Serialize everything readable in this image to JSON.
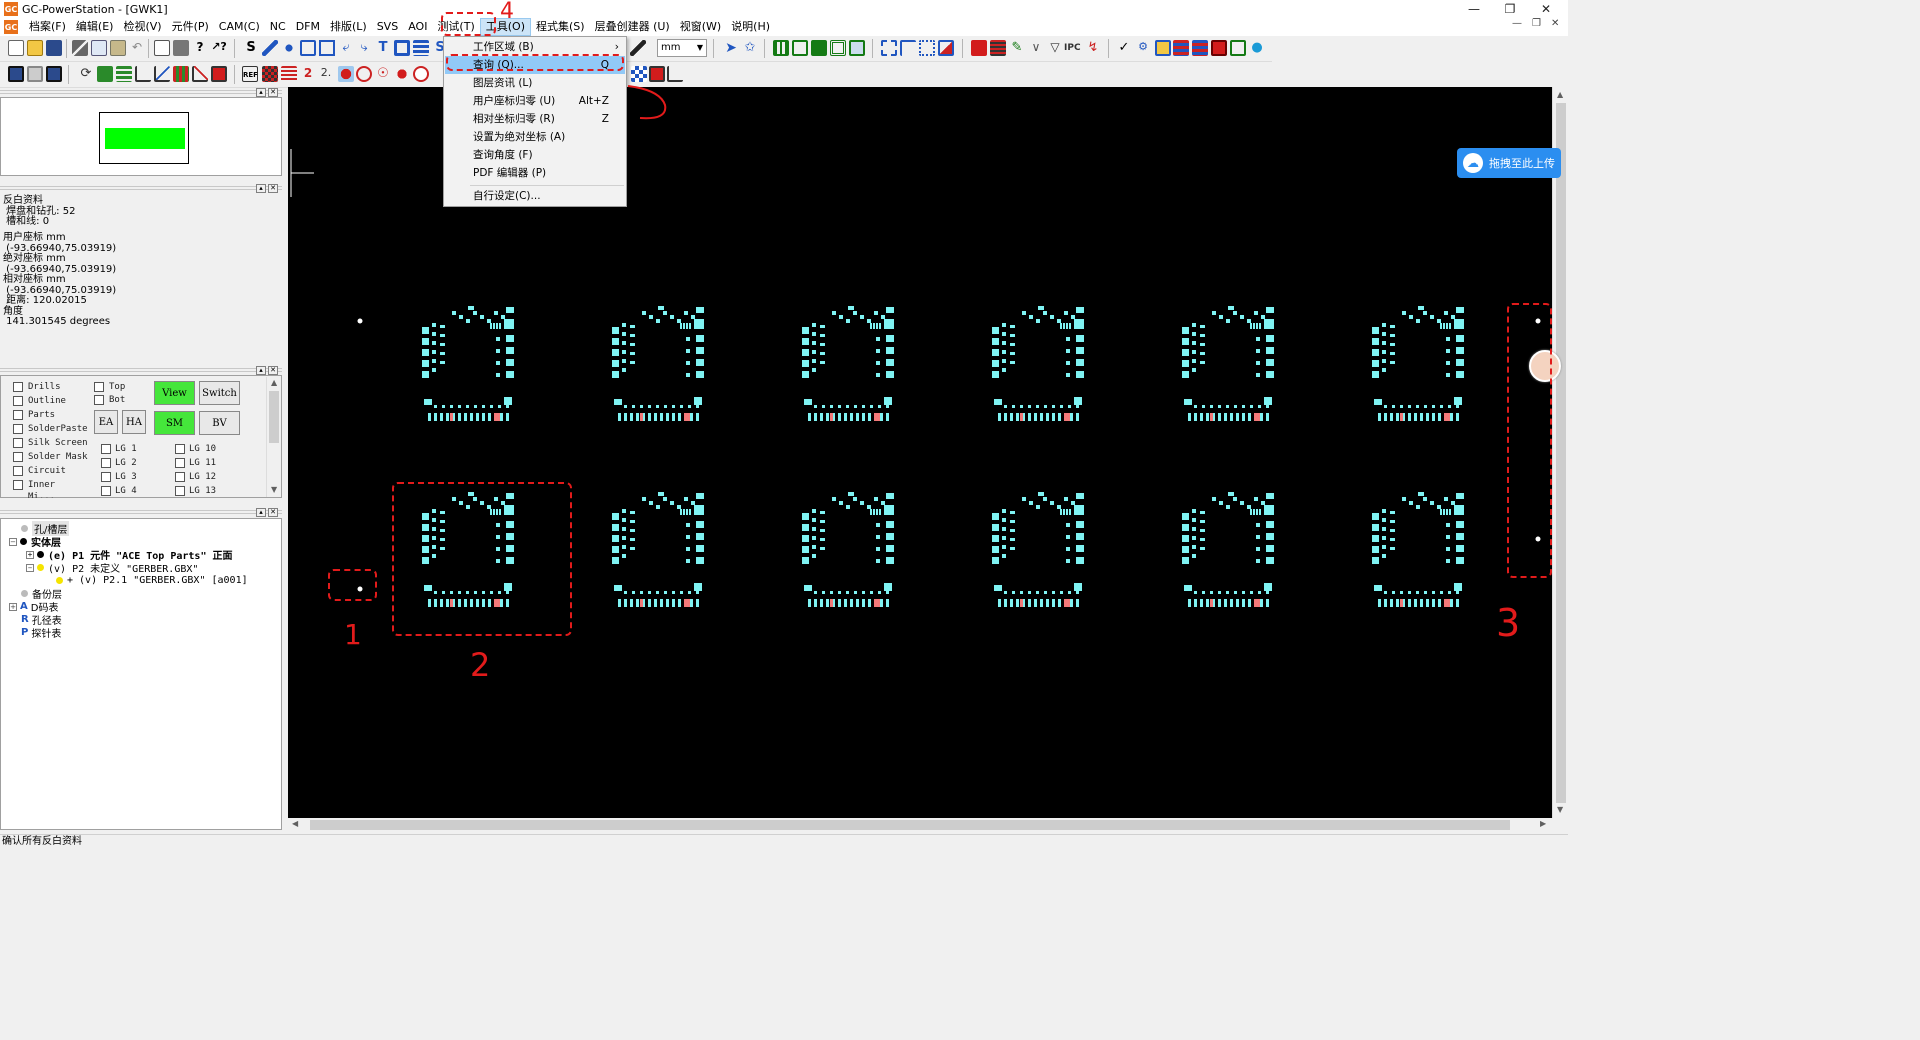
{
  "window": {
    "title": "GC-PowerStation - [GWK1]",
    "logo_text": "GC"
  },
  "menubar": {
    "items": [
      {
        "label": "档案(F)"
      },
      {
        "label": "编辑(E)"
      },
      {
        "label": "检视(V)"
      },
      {
        "label": "元件(P)"
      },
      {
        "label": "CAM(C)"
      },
      {
        "label": "NC"
      },
      {
        "label": "DFM"
      },
      {
        "label": "排版(L)"
      },
      {
        "label": "SVS"
      },
      {
        "label": "AOI"
      },
      {
        "label": "测试(T)"
      },
      {
        "label": "工具(O)"
      },
      {
        "label": "程式集(S)"
      },
      {
        "label": "层叠创建器 (U)"
      },
      {
        "label": "视窗(W)"
      },
      {
        "label": "说明(H)"
      }
    ]
  },
  "toolbar": {
    "unit_select": "mm"
  },
  "tools_menu": {
    "items": [
      {
        "label": "工作区域 (B)",
        "shortcut": "",
        "submenu": true
      },
      {
        "label": "查询 (Q)...",
        "shortcut": "Q",
        "highlighted": true
      },
      {
        "label": "图层资讯 (L)",
        "shortcut": ""
      },
      {
        "label": "用户座标归零 (U)",
        "shortcut": "Alt+Z"
      },
      {
        "label": "相对坐标归零 (R)",
        "shortcut": "Z"
      },
      {
        "label": "设置为绝对坐标 (A)",
        "shortcut": ""
      },
      {
        "label": "查询角度 (F)",
        "shortcut": ""
      },
      {
        "label": "PDF 编辑器 (P)",
        "shortcut": ""
      },
      {
        "label": "自行设定(C)...",
        "shortcut": ""
      }
    ]
  },
  "info_panel": {
    "lines": [
      "反白资料",
      " 焊盘和钻孔: 52",
      " 槽和线: 0",
      "用户座标 mm",
      " (-93.66940,75.03919)",
      "绝对座标 mm",
      " (-93.66940,75.03919)",
      "相对座标 mm",
      " (-93.66940,75.03919)",
      " 距离: 120.02015",
      "角度",
      " 141.301545 degrees"
    ]
  },
  "layer_panel": {
    "layers": [
      {
        "label": "Drills"
      },
      {
        "label": "Outline"
      },
      {
        "label": "Parts"
      },
      {
        "label": "SolderPaste"
      },
      {
        "label": "Silk Screen"
      },
      {
        "label": "Solder Mask"
      },
      {
        "label": "Circuit"
      },
      {
        "label": "Inner"
      },
      {
        "label": "Mi..."
      }
    ],
    "sides": [
      {
        "label": "Top"
      },
      {
        "label": "Bot"
      }
    ],
    "buttons": {
      "view": "View",
      "switch": "Switch",
      "ea": "EA",
      "ha": "HA",
      "sm": "SM",
      "bv": "BV"
    },
    "lg_left": [
      {
        "label": "LG 1"
      },
      {
        "label": "LG 2"
      },
      {
        "label": "LG 3"
      },
      {
        "label": "LG 4"
      }
    ],
    "lg_right": [
      {
        "label": "LG 10"
      },
      {
        "label": "LG 11"
      },
      {
        "label": "LG 12"
      },
      {
        "label": "LG 13"
      }
    ],
    "accent_color": "#45e63b"
  },
  "tree_panel": {
    "rows": [
      {
        "label": "孔/槽层"
      },
      {
        "label": "实体层"
      },
      {
        "label": "(e) P1 元件 \"ACE Top Parts\" 正面"
      },
      {
        "label": "(v) P2 未定义 \"GERBER.GBX\""
      },
      {
        "label": "+ (v) P2.1 \"GERBER.GBX\" [a001]"
      },
      {
        "label": "备份层"
      },
      {
        "label": "D码表"
      },
      {
        "label": "孔径表"
      },
      {
        "label": "探针表"
      }
    ]
  },
  "statusbar": {
    "text": "确认所有反白资料"
  },
  "upload_button": {
    "label": "拖拽至此上传"
  },
  "annotations": {
    "labels": [
      "4",
      "1",
      "2",
      "3"
    ],
    "color": "#e21b1b"
  },
  "pcb": {
    "pad_color": "#7ff3f3",
    "accent_pad_color": "#f27a7a"
  }
}
